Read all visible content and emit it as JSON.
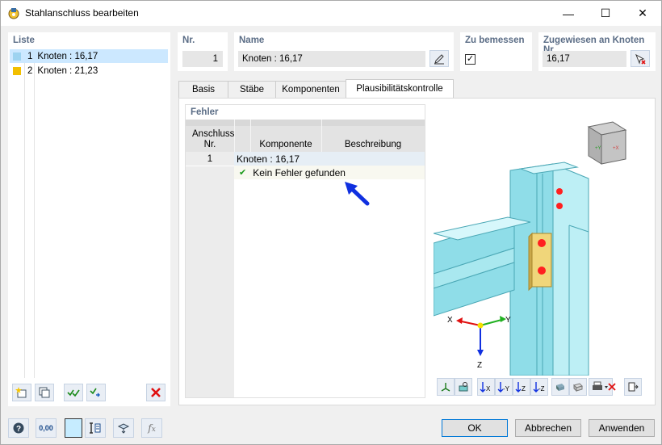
{
  "window": {
    "title": "Stahlanschluss bearbeiten",
    "minimize_glyph": "—",
    "maximize_glyph": "☐",
    "close_glyph": "✕"
  },
  "list": {
    "header": "Liste",
    "items": [
      {
        "num": "1",
        "label": "Knoten : 16,17",
        "color": "#9dd3f0"
      },
      {
        "num": "2",
        "label": "Knoten : 21,23",
        "color": "#f2bf00"
      }
    ]
  },
  "header_fields": {
    "nr_label": "Nr.",
    "nr_value": "1",
    "name_label": "Name",
    "name_value": "Knoten : 16,17",
    "to_design_label": "Zu bemessen",
    "to_design_checked": "✓",
    "assigned_label": "Zugewiesen an Knoten Nr.",
    "assigned_value": "16,17"
  },
  "tabs": [
    {
      "label": "Basis"
    },
    {
      "label": "Stäbe"
    },
    {
      "label": "Komponenten"
    },
    {
      "label": "Plausibilitätskontrolle"
    }
  ],
  "errors_table": {
    "section_title": "Fehler",
    "col_connection": "Anschluss Nr.",
    "col_component": "Komponente",
    "col_description": "Beschreibung",
    "row_no": "1",
    "group_label": "Knoten : 16,17",
    "status_check": "✔",
    "status_text": "Kein Fehler gefunden"
  },
  "view3d": {
    "axis_x": "X",
    "axis_y": "Y",
    "axis_z": "Z",
    "beam_color": "#8fdde8",
    "plate_color": "#f0d67a",
    "bolt_color": "#ff2020"
  },
  "buttons": {
    "ok": "OK",
    "cancel": "Abbrechen",
    "apply": "Anwenden"
  },
  "bottom_tools": {
    "units_label": "0,00"
  },
  "colors": {
    "accent": "#0078d7",
    "header_text": "#5b6d86",
    "arrow": "#1030e0"
  }
}
